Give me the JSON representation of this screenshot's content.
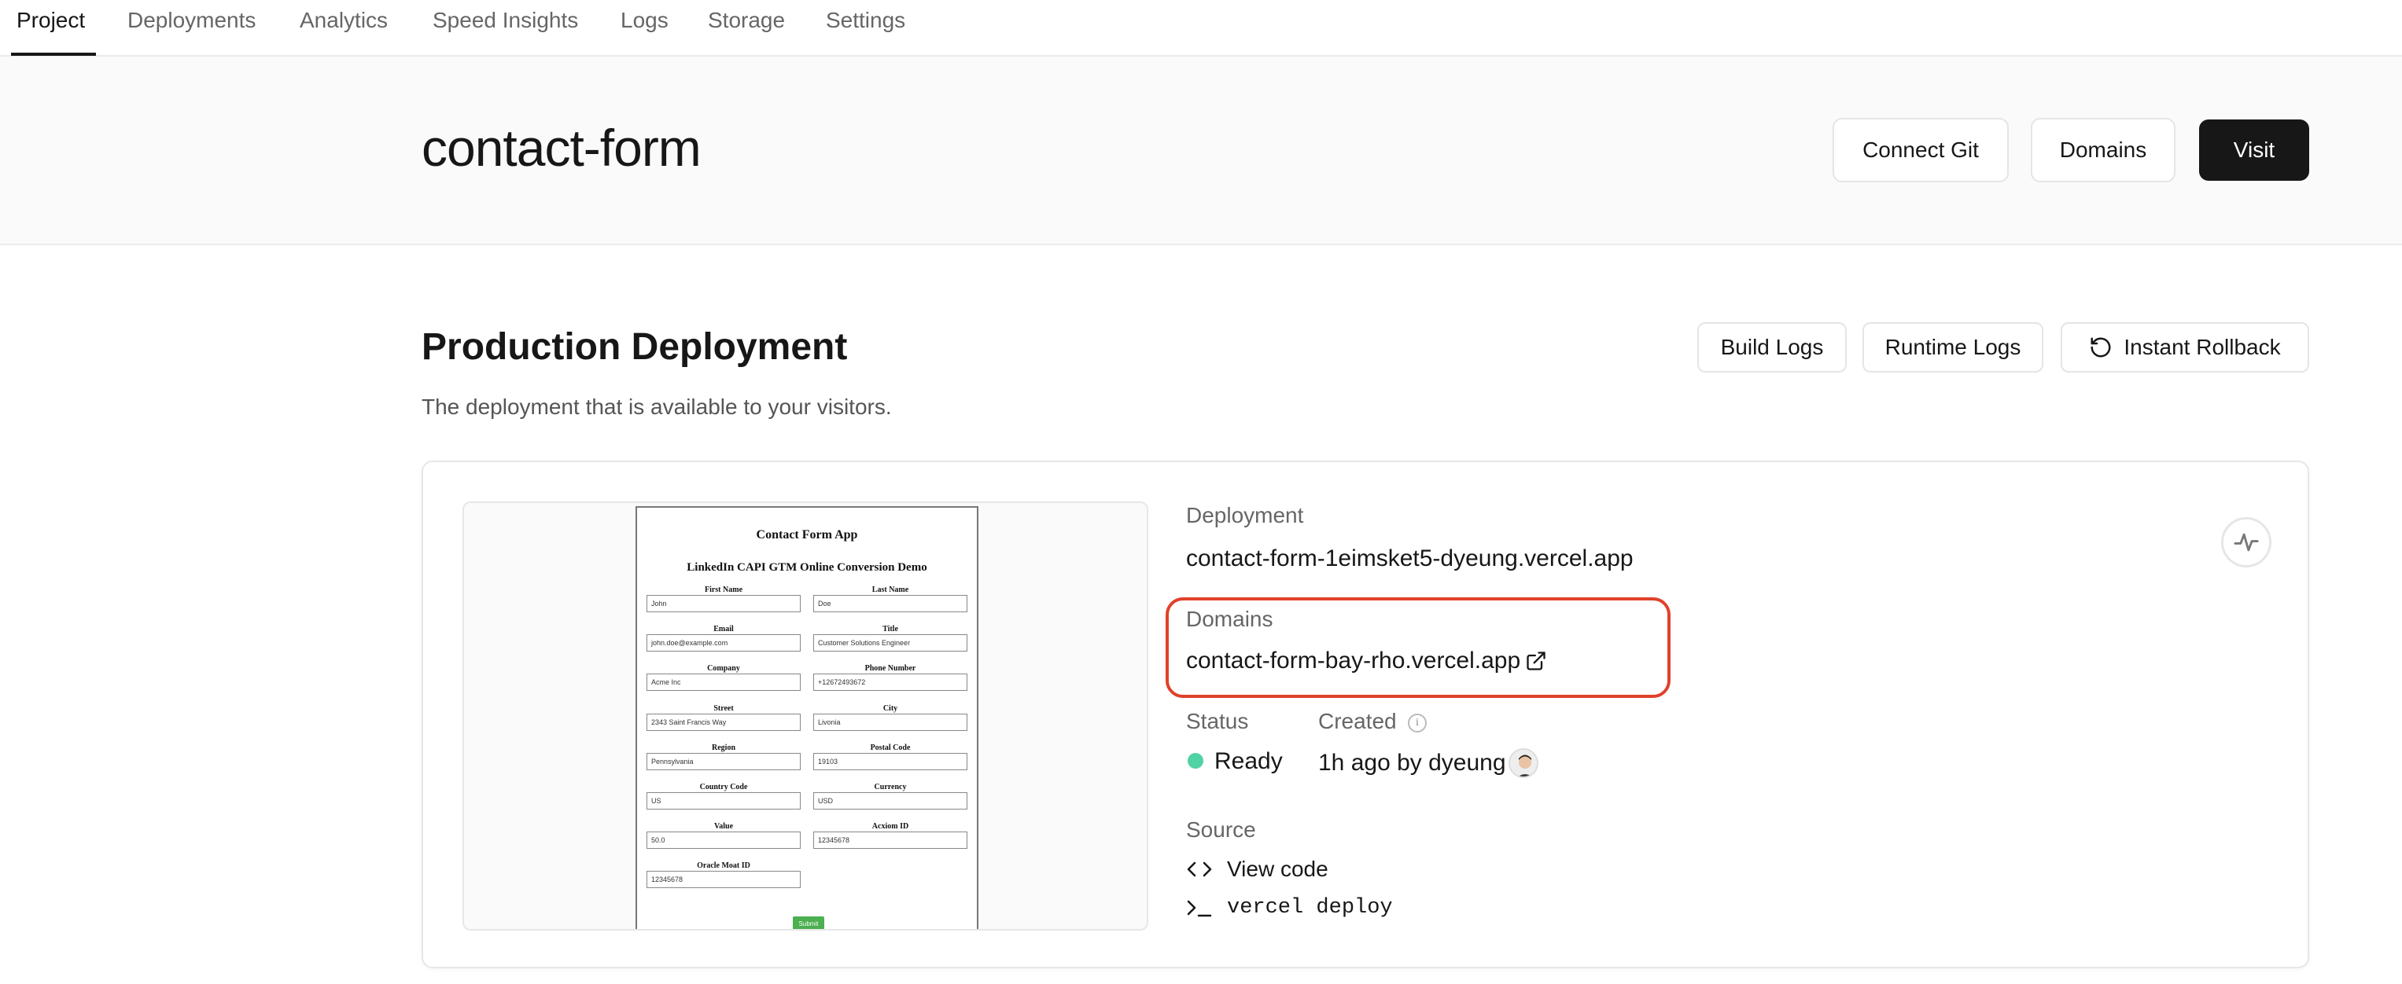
{
  "nav": {
    "tabs": [
      {
        "label": "Project",
        "active": true
      },
      {
        "label": "Deployments",
        "active": false
      },
      {
        "label": "Analytics",
        "active": false
      },
      {
        "label": "Speed Insights",
        "active": false
      },
      {
        "label": "Logs",
        "active": false
      },
      {
        "label": "Storage",
        "active": false
      },
      {
        "label": "Settings",
        "active": false
      }
    ]
  },
  "header": {
    "title": "contact-form",
    "connect_git_label": "Connect Git",
    "domains_label": "Domains",
    "visit_label": "Visit"
  },
  "production": {
    "title": "Production Deployment",
    "subtitle": "The deployment that is available to your visitors.",
    "build_logs_label": "Build Logs",
    "runtime_logs_label": "Runtime Logs",
    "rollback_label": "Instant Rollback",
    "rollback_icon": "rotate-ccw-icon"
  },
  "preview": {
    "title": "Contact Form App",
    "subtitle": "LinkedIn CAPI GTM Online Conversion Demo",
    "fields": [
      {
        "label": "First Name",
        "value": "John"
      },
      {
        "label": "Last Name",
        "value": "Doe"
      },
      {
        "label": "Email",
        "value": "john.doe@example.com"
      },
      {
        "label": "Title",
        "value": "Customer Solutions Engineer"
      },
      {
        "label": "Company",
        "value": "Acme Inc"
      },
      {
        "label": "Phone Number",
        "value": "+12672493672"
      },
      {
        "label": "Street",
        "value": "2343 Saint Francis Way"
      },
      {
        "label": "City",
        "value": "Livonia"
      },
      {
        "label": "Region",
        "value": "Pennsylvania"
      },
      {
        "label": "Postal Code",
        "value": "19103"
      },
      {
        "label": "Country Code",
        "value": "US"
      },
      {
        "label": "Currency",
        "value": "USD"
      },
      {
        "label": "Value",
        "value": "50.0"
      },
      {
        "label": "Acxiom ID",
        "value": "12345678"
      },
      {
        "label": "Oracle Moat ID",
        "value": "12345678"
      }
    ],
    "submit_label": "Submit"
  },
  "details": {
    "deployment_label": "Deployment",
    "deployment_url": "contact-form-1eimsket5-dyeung.vercel.app",
    "domains_label": "Domains",
    "domain_url": "contact-form-bay-rho.vercel.app",
    "status_label": "Status",
    "status_value": "Ready",
    "status_color": "#50d3a4",
    "created_label": "Created",
    "created_value": "1h ago by dyeung",
    "source_label": "Source",
    "view_code_label": "View code",
    "cli_command": "vercel deploy"
  },
  "colors": {
    "accent_dark": "#171717",
    "highlight": "#e0412b",
    "ready": "#50d3a4"
  }
}
